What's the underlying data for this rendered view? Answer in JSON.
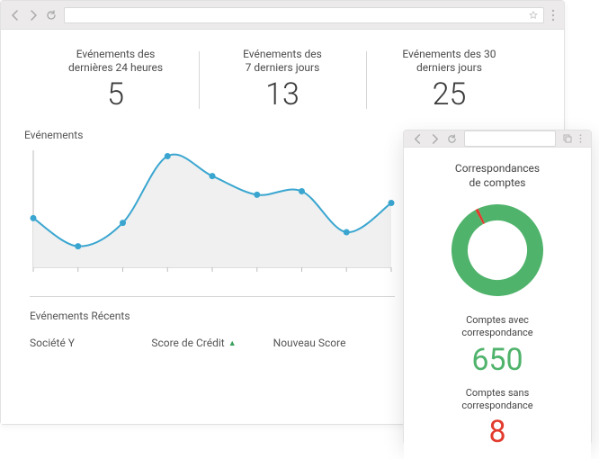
{
  "stats": [
    {
      "label_l1": "Evénements des",
      "label_l2": "dernières 24 heures",
      "value": "5"
    },
    {
      "label_l1": "Evénements des",
      "label_l2": "7 derniers jours",
      "value": "13"
    },
    {
      "label_l1": "Evénements des 30",
      "label_l2": "derniers jours",
      "value": "25"
    }
  ],
  "events_section_title": "Evénements",
  "recent_section_title": "Evénements Récents",
  "table": {
    "col0": "Société Y",
    "col1": "Score de Crédit",
    "col2": "Nouveau Score"
  },
  "small": {
    "title_l1": "Correspondances",
    "title_l2": "de comptes",
    "matched_label_l1": "Comptes avec",
    "matched_label_l2": "correspondance",
    "matched_value": "650",
    "unmatched_label_l1": "Comptes sans",
    "unmatched_label_l2": "correspondance",
    "unmatched_value": "8"
  },
  "colors": {
    "line": "#3aa6d0",
    "fill": "#f0f0f0",
    "green": "#4fb36b",
    "red": "#e23c2e"
  },
  "chart_data": {
    "type": "line",
    "title": "Evénements",
    "x": [
      0,
      1,
      2,
      3,
      4,
      5,
      6,
      7,
      8
    ],
    "values": [
      42,
      18,
      38,
      95,
      78,
      62,
      65,
      30,
      55
    ],
    "ylim": [
      0,
      100
    ],
    "xlabel": "",
    "ylabel": ""
  },
  "donut_data": {
    "type": "pie",
    "series": [
      {
        "name": "Comptes avec correspondance",
        "value": 650,
        "color": "#4fb36b"
      },
      {
        "name": "Comptes sans correspondance",
        "value": 8,
        "color": "#e23c2e"
      }
    ]
  }
}
